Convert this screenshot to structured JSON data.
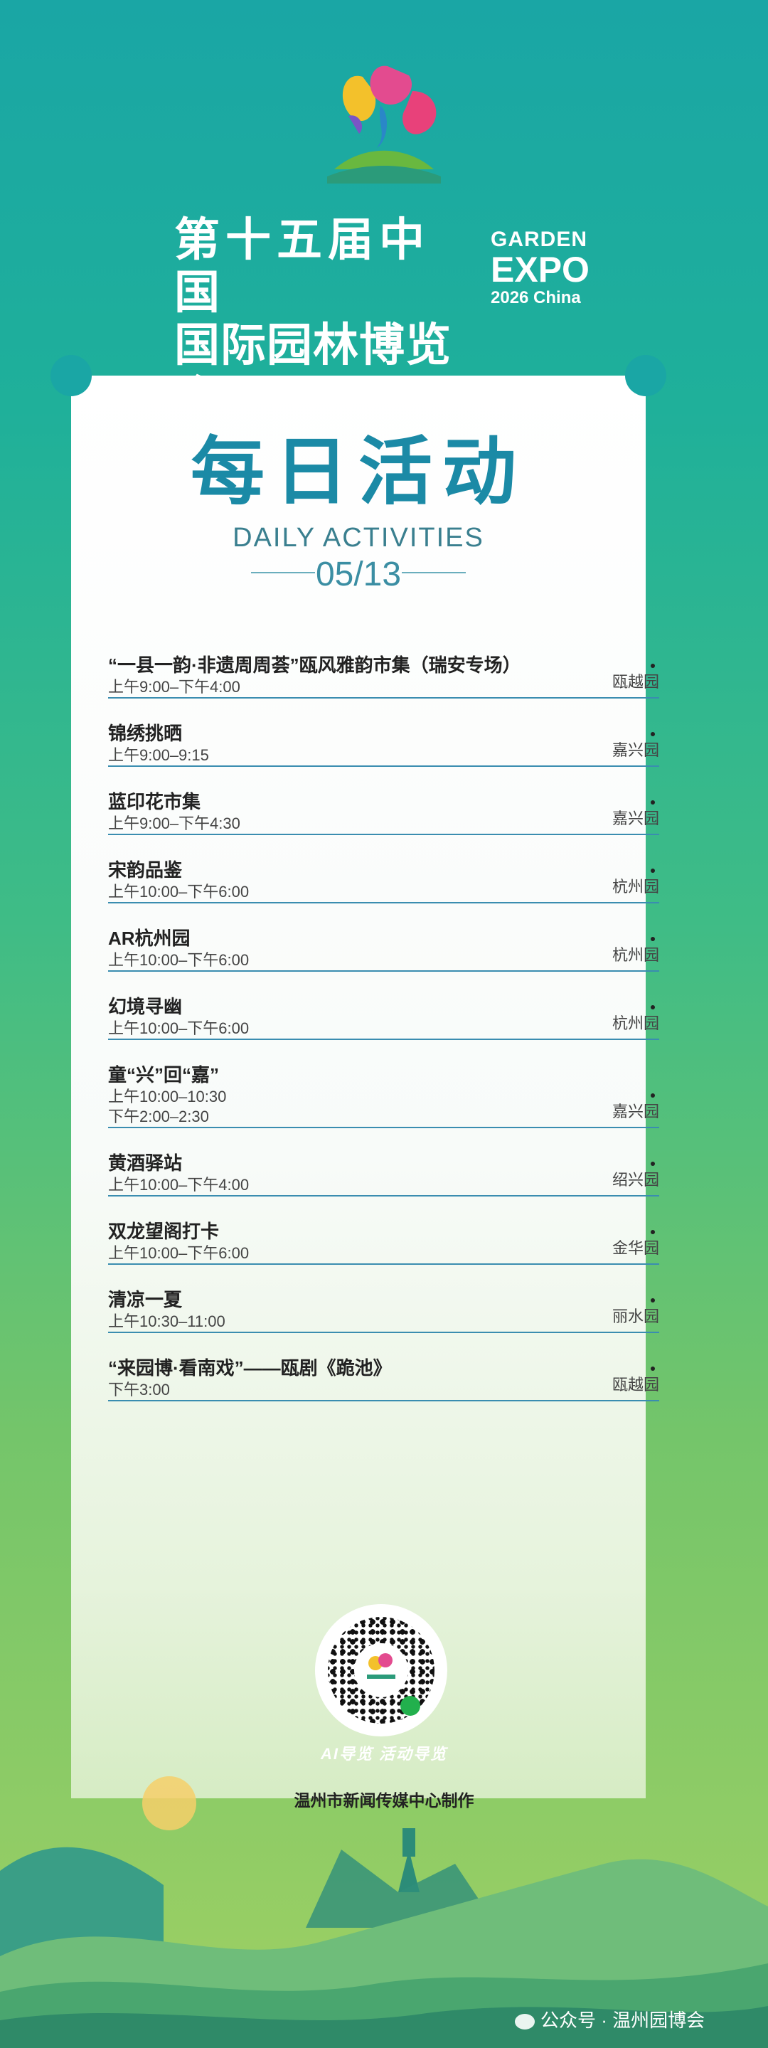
{
  "header": {
    "title_line1": "第十五届中国",
    "title_line2": "国际园林博览会",
    "en_line1": "GARDEN",
    "en_line2": "EXPO",
    "en_line3": "2026 China"
  },
  "card": {
    "title": "每日活动",
    "subtitle": "DAILY ACTIVITIES",
    "date": "05/13"
  },
  "events": [
    {
      "name": "“一县一韵·非遗周周荟”瓯风雅韵市集（瑞安专场）",
      "time": "上午9:00–下午4:00",
      "location": "瓯越园"
    },
    {
      "name": "锦绣挑晒",
      "time": "上午9:00–9:15",
      "location": "嘉兴园"
    },
    {
      "name": "蓝印花市集",
      "time": "上午9:00–下午4:30",
      "location": "嘉兴园"
    },
    {
      "name": "宋韵品鉴",
      "time": "上午10:00–下午6:00",
      "location": "杭州园"
    },
    {
      "name": "AR杭州园",
      "time": "上午10:00–下午6:00",
      "location": "杭州园"
    },
    {
      "name": "幻境寻幽",
      "time": "上午10:00–下午6:00",
      "location": "杭州园"
    },
    {
      "name": "童“兴”回“嘉”",
      "time": "上午10:00–10:30",
      "time2": "下午2:00–2:30",
      "location": "嘉兴园"
    },
    {
      "name": "黄酒驿站",
      "time": "上午10:00–下午4:00",
      "location": "绍兴园"
    },
    {
      "name": "双龙望阁打卡",
      "time": "上午10:00–下午6:00",
      "location": "金华园"
    },
    {
      "name": "清凉一夏",
      "time": "上午10:30–11:00",
      "location": "丽水园"
    },
    {
      "name": "“来园博·看南戏”——瓯剧《跪池》",
      "time": "下午3:00",
      "location": "瓯越园"
    }
  ],
  "footer": {
    "slogan": "AI导览 活动导览",
    "credit": "温州市新闻传媒中心制作",
    "wechat": "公众号 · 温州园博会"
  },
  "colors": {
    "teal": "#1aa6a5",
    "title_blue": "#1b8aa6",
    "divider": "#3a8db0"
  }
}
